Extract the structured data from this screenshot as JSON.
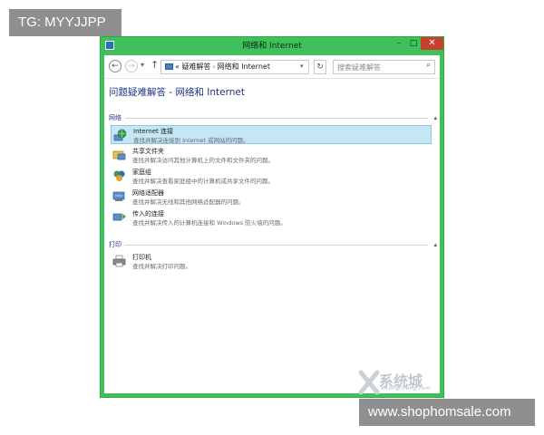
{
  "overlay": {
    "tag_label": "TG: MYYJJPP",
    "site_label": "www.shophomsale.com"
  },
  "window": {
    "title": "网络和 Internet",
    "controls": {
      "minimize": "–",
      "maximize": "□",
      "close": "✕"
    },
    "accent_color": "#3fc05a"
  },
  "address": {
    "prefix": "«",
    "path": [
      "疑难解答",
      "网络和 Internet"
    ],
    "search_placeholder": "搜索疑难解答"
  },
  "main": {
    "title": "问题疑难解答 - 网络和 Internet",
    "groups": [
      {
        "label": "网络",
        "items": [
          {
            "title": "Internet 连接",
            "desc": "查找并解决连接到 Internet 或网站的问题。",
            "icon": "globe-network-icon",
            "selected": true
          },
          {
            "title": "共享文件夹",
            "desc": "查找并解决访问其他计算机上的文件和文件夹的问题。",
            "icon": "shared-folder-icon",
            "selected": false
          },
          {
            "title": "家庭组",
            "desc": "查找并解决查看家庭组中的计算机或共享文件的问题。",
            "icon": "homegroup-icon",
            "selected": false
          },
          {
            "title": "网络适配器",
            "desc": "查找并解决无线和其他网络适配器的问题。",
            "icon": "network-adapter-icon",
            "selected": false
          },
          {
            "title": "传入的连接",
            "desc": "查找并解决传入的计算机连接和 Windows 防火墙的问题。",
            "icon": "incoming-connection-icon",
            "selected": false
          }
        ]
      },
      {
        "label": "打印",
        "items": [
          {
            "title": "打印机",
            "desc": "查找并解决打印问题。",
            "icon": "printer-icon",
            "selected": false
          }
        ]
      }
    ]
  },
  "watermark": {
    "text": "系统城",
    "sub": "xitongcheng.com"
  }
}
